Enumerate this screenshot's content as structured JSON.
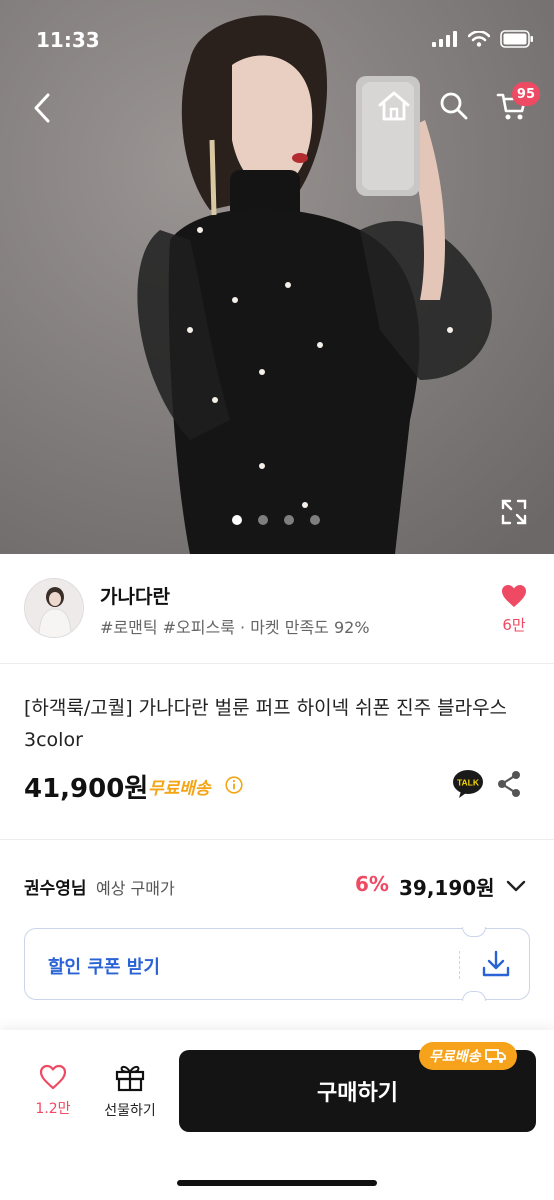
{
  "status_bar": {
    "time": "11:33"
  },
  "cart": {
    "badge_count": "95"
  },
  "gallery": {
    "page_count": 4,
    "active_index": 0
  },
  "seller": {
    "name": "가나다란",
    "tags": "#로맨틱 #오피스룩 · 마켓 만족도 92%",
    "like_count": "6만"
  },
  "product": {
    "title": "[하객룩/고퀄] 가나다란 벌룬 퍼프 하이넥 쉬폰 진주 블라우스 3color",
    "price": "41,900원",
    "shipping": "무료배송"
  },
  "talk_label": "TALK",
  "member_price": {
    "name": "권수영님",
    "label": "예상 구매가",
    "discount": "6%",
    "price": "39,190원"
  },
  "coupon": {
    "label": "할인 쿠폰 받기"
  },
  "bottom_bar": {
    "wish_count": "1.2만",
    "gift_label": "선물하기",
    "buy_label": "구매하기",
    "buy_badge": "무료배송"
  },
  "colors": {
    "accent_pink": "#ef4a63",
    "shipping_orange": "#f3a516",
    "coupon_blue": "#2a63d6",
    "buy_button": "#141414"
  },
  "icons": [
    "back-icon",
    "home-icon",
    "search-icon",
    "cart-icon",
    "expand-icon",
    "heart-icon",
    "info-icon",
    "talk-icon",
    "share-icon",
    "chevron-down-icon",
    "download-icon",
    "gift-icon",
    "truck-icon"
  ]
}
